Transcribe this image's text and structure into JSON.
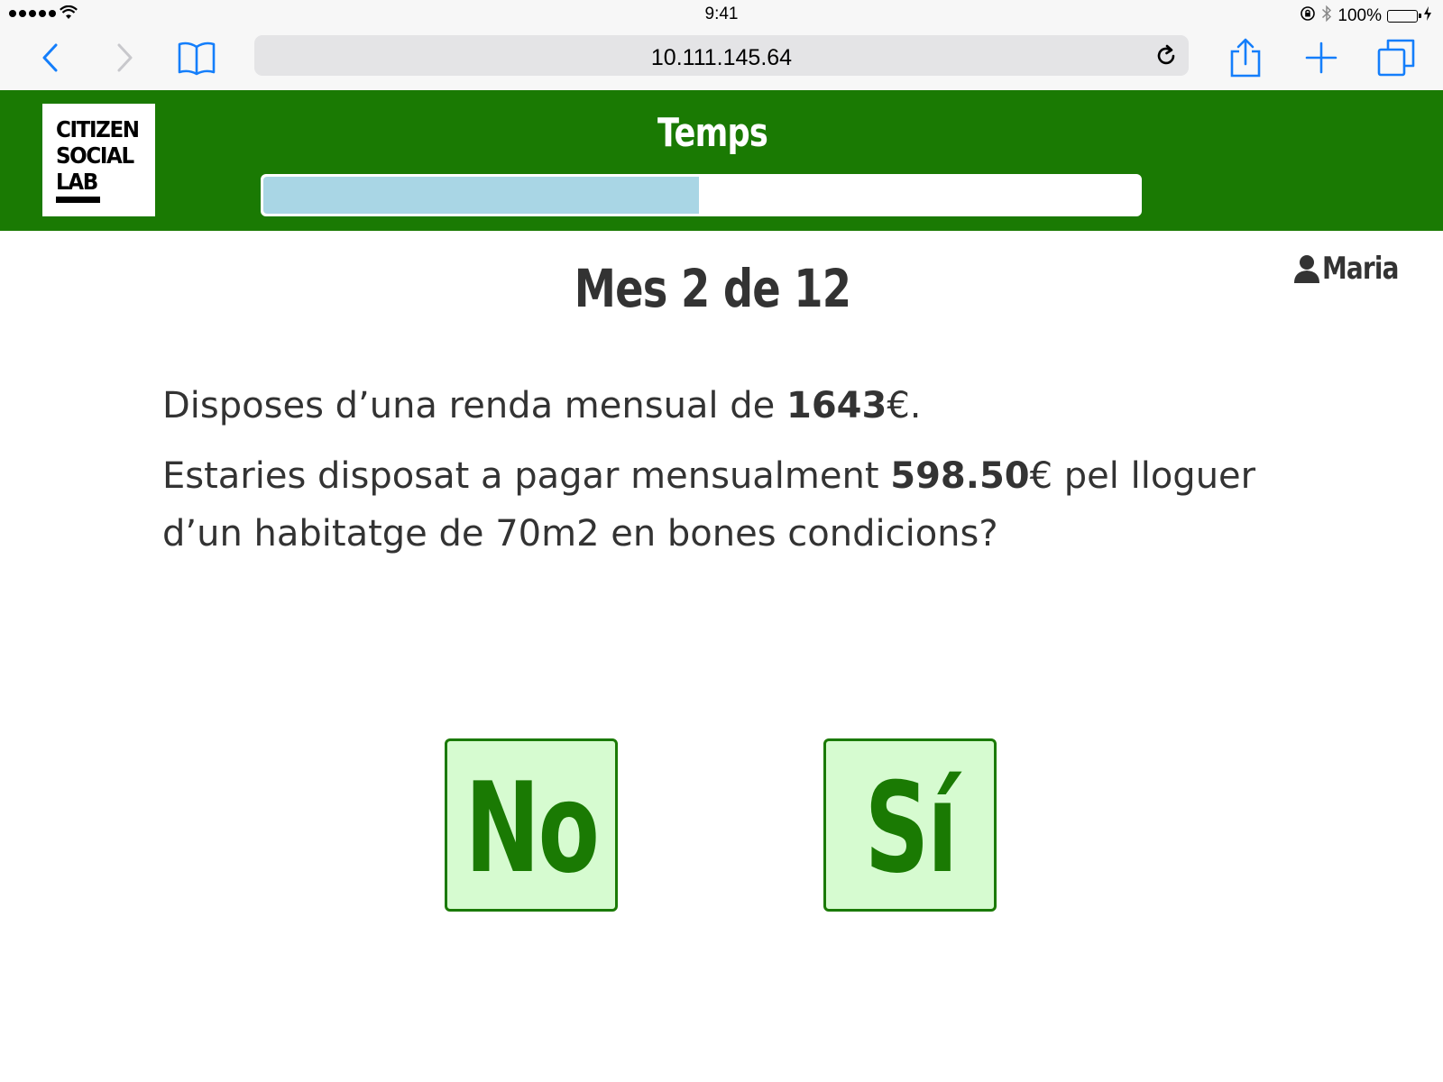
{
  "status_bar": {
    "time": "9:41",
    "battery_percent": "100%",
    "battery_level": 1.0
  },
  "browser": {
    "url": "10.111.145.64",
    "icons": {
      "back": "chevron-left-icon",
      "forward": "chevron-right-icon",
      "bookmarks": "book-icon",
      "reload": "reload-icon",
      "share": "share-icon",
      "new_tab": "plus-icon",
      "tabs": "tabs-icon"
    }
  },
  "header": {
    "logo_lines": [
      "CITIZEN",
      "SOCIAL",
      "LAB"
    ],
    "title": "Temps",
    "timer_progress": 0.497
  },
  "user": {
    "name": "Maria",
    "icon": "user-icon"
  },
  "month": {
    "label": "Mes 2 de 12"
  },
  "question": {
    "line1_prefix": "Disposes d’una renda mensual de ",
    "income": "1643",
    "line1_suffix": "€.",
    "line2_prefix": "Estaries disposat a pagar mensualment ",
    "rent": "598.50",
    "line2_suffix": "€ pel lloguer d’un habitatge de 70m2 en bones condicions?"
  },
  "answers": {
    "no": "No",
    "yes": "Sí"
  },
  "colors": {
    "header_green": "#1a7a03",
    "progress_blue": "#a9d6e5",
    "answer_bg": "#d6fbd0",
    "text_dark": "#333333",
    "ios_blue": "#147efb"
  }
}
